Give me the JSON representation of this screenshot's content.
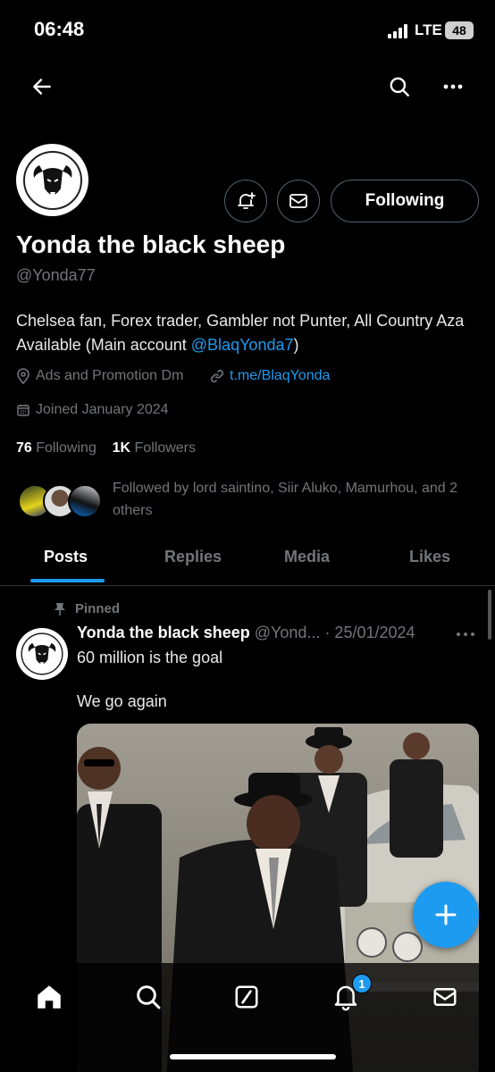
{
  "status_bar": {
    "time": "06:48",
    "network": "LTE",
    "battery": "48"
  },
  "profile": {
    "name": "Yonda the black sheep",
    "handle": "@Yonda77",
    "bio_text": "Chelsea fan, Forex trader, Gambler not Punter, All Country Aza Available (Main account ",
    "bio_mention": "@BlaqYonda7",
    "bio_end": ")",
    "location": "Ads and Promotion Dm",
    "website": "t.me/BlaqYonda",
    "joined": "Joined January 2024",
    "following_count": "76",
    "following_label": "Following",
    "followers_count": "1K",
    "followers_label": "Followers",
    "followed_by": "Followed by lord saintino, Siir Aluko, Mamurhou, and 2 others",
    "follow_button": "Following"
  },
  "tabs": [
    "Posts",
    "Replies",
    "Media",
    "Likes"
  ],
  "active_tab": "Posts",
  "post": {
    "pinned_label": "Pinned",
    "author_name": "Yonda the black sheep",
    "author_handle": "@Yond...",
    "date": "· 25/01/2024",
    "line1": "60 million is the goal",
    "line2": "We go again"
  },
  "nav": {
    "notification_count": "1"
  },
  "colors": {
    "accent": "#1d9bf0",
    "background": "#000000",
    "muted": "#71767b"
  }
}
